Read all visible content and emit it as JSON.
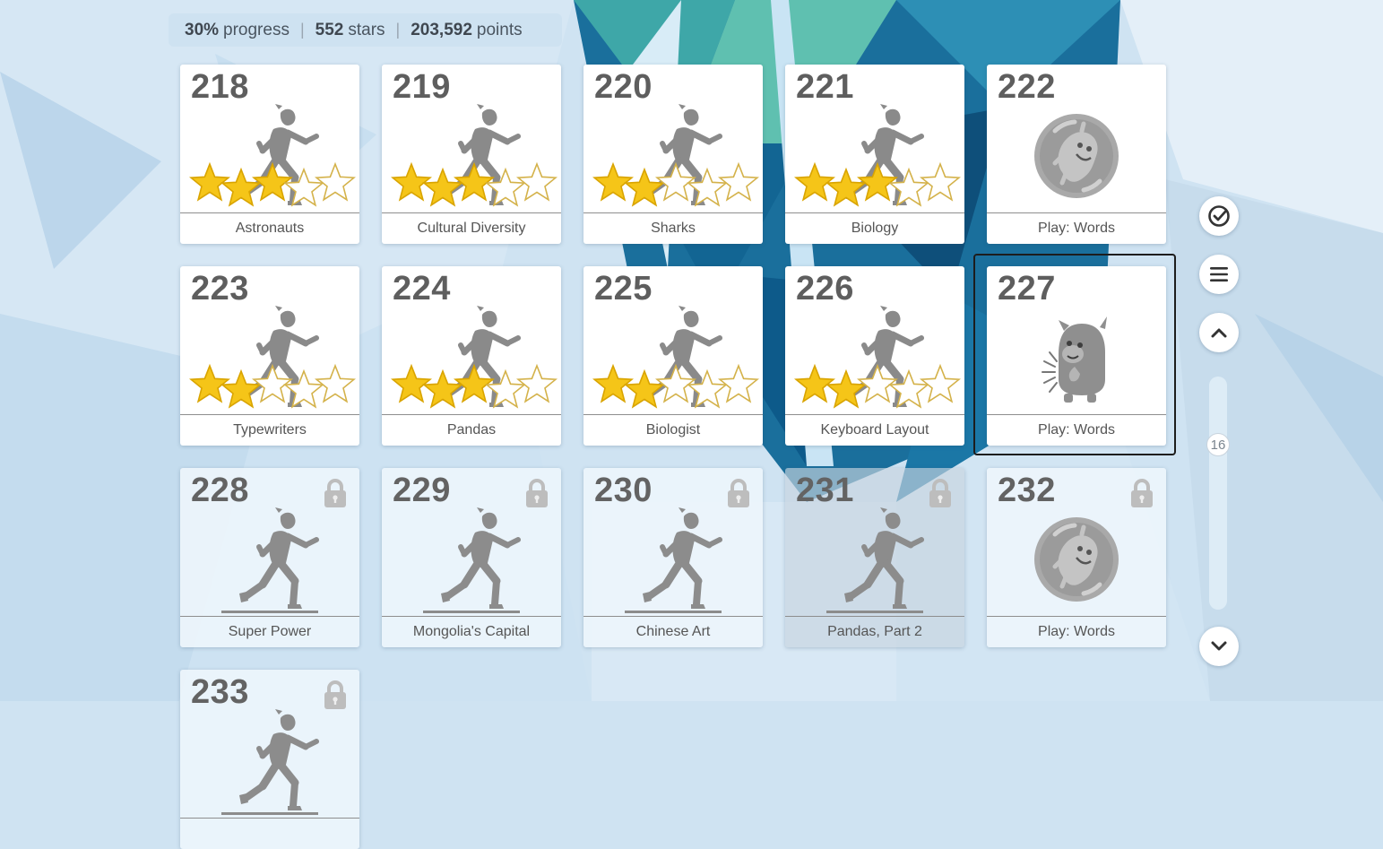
{
  "stats": {
    "progress_value": "30%",
    "progress_label": "progress",
    "stars_value": "552",
    "stars_label": "stars",
    "points_value": "203,592",
    "points_label": "points"
  },
  "lessons": [
    {
      "number": "218",
      "title": "Astronauts",
      "kind": "runner",
      "stars": 3,
      "status": "completed"
    },
    {
      "number": "219",
      "title": "Cultural Diversity",
      "kind": "runner",
      "stars": 3,
      "status": "completed"
    },
    {
      "number": "220",
      "title": "Sharks",
      "kind": "runner",
      "stars": 2,
      "status": "completed"
    },
    {
      "number": "221",
      "title": "Biology",
      "kind": "runner",
      "stars": 3,
      "status": "completed"
    },
    {
      "number": "222",
      "title": "Play: Words",
      "kind": "game-bubble",
      "status": "completed"
    },
    {
      "number": "223",
      "title": "Typewriters",
      "kind": "runner",
      "stars": 2,
      "status": "completed"
    },
    {
      "number": "224",
      "title": "Pandas",
      "kind": "runner",
      "stars": 3,
      "status": "completed"
    },
    {
      "number": "225",
      "title": "Biologist",
      "kind": "runner",
      "stars": 2,
      "status": "completed"
    },
    {
      "number": "226",
      "title": "Keyboard Layout",
      "kind": "runner",
      "stars": 2,
      "status": "completed"
    },
    {
      "number": "227",
      "title": "Play: Words",
      "kind": "game-monster",
      "status": "selected"
    },
    {
      "number": "228",
      "title": "Super Power",
      "kind": "runner",
      "status": "locked"
    },
    {
      "number": "229",
      "title": "Mongolia's Capital",
      "kind": "runner",
      "status": "locked"
    },
    {
      "number": "230",
      "title": "Chinese Art",
      "kind": "runner",
      "status": "locked"
    },
    {
      "number": "231",
      "title": "Pandas, Part 2",
      "kind": "runner",
      "status": "locked"
    },
    {
      "number": "232",
      "title": "Play: Words",
      "kind": "game-bubble",
      "status": "locked"
    },
    {
      "number": "233",
      "title": "",
      "kind": "runner",
      "status": "locked"
    }
  ],
  "max_stars": 5,
  "scroll": {
    "page_indicator": "16"
  },
  "icons": {
    "check": "check-circle-icon",
    "menu": "hamburger-menu-icon",
    "up": "chevron-up-icon",
    "down": "chevron-down-icon",
    "lock": "lock-icon"
  },
  "colors": {
    "star_gold": "#f5c518",
    "figure_gray": "#8a8a8a"
  }
}
